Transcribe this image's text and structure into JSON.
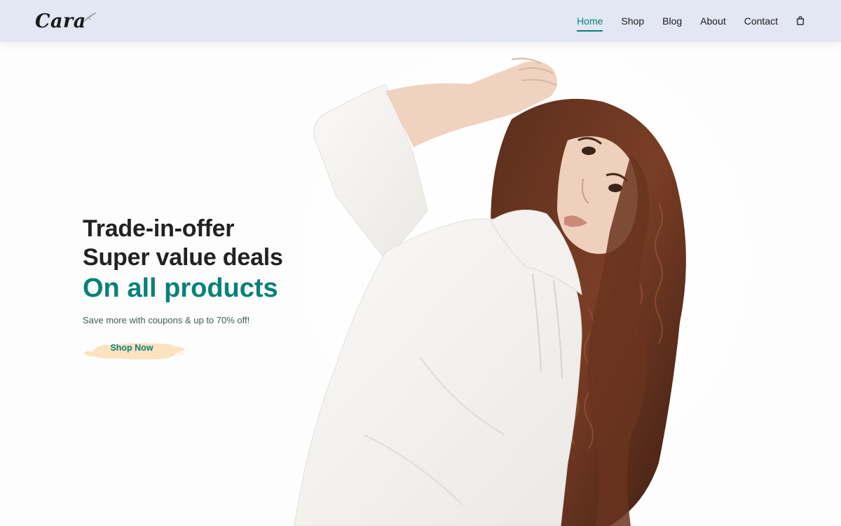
{
  "header": {
    "logo": "Cara",
    "nav": [
      {
        "label": "Home",
        "active": true
      },
      {
        "label": "Shop",
        "active": false
      },
      {
        "label": "Blog",
        "active": false
      },
      {
        "label": "About",
        "active": false
      },
      {
        "label": "Contact",
        "active": false
      }
    ],
    "bag_icon": "shopping-bag-icon"
  },
  "hero": {
    "line1": "Trade-in-offer",
    "line2": "Super value deals",
    "headline": "On all products",
    "subtext": "Save more with coupons & up to 70% off!",
    "button_label": "Shop Now",
    "image": "model-in-white-sweatshirt"
  },
  "colors": {
    "accent": "#088178",
    "header_bg": "#e3e6f3",
    "button_brush": "#fce3c0",
    "text_dark": "#222222"
  }
}
